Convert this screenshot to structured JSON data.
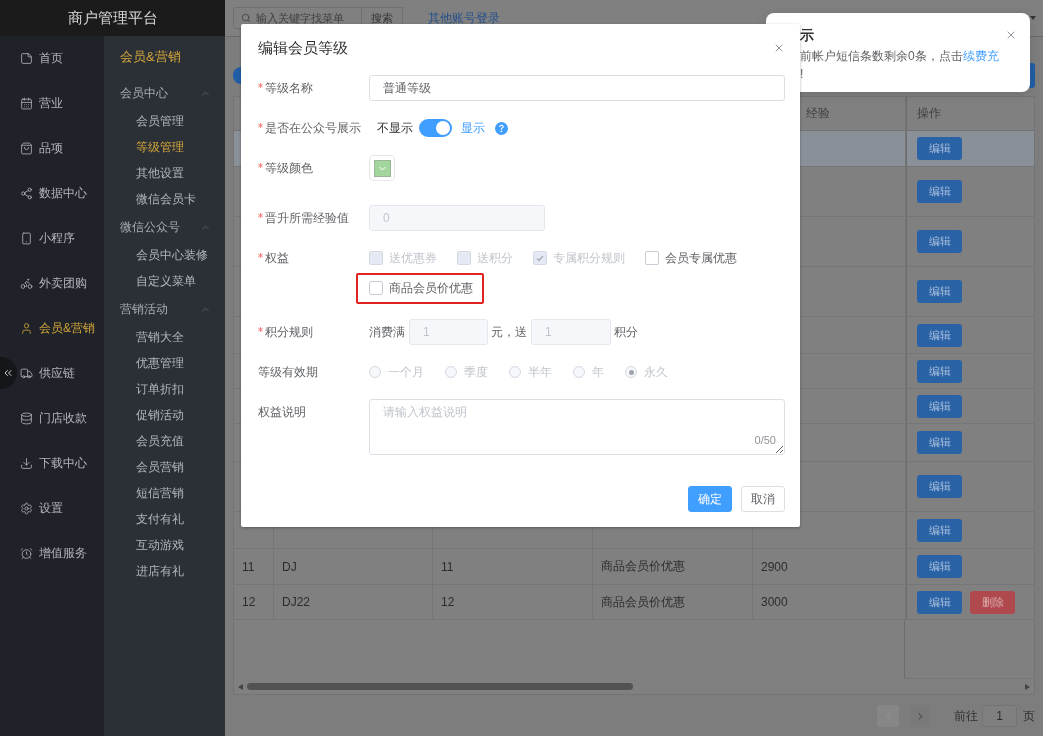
{
  "sidebar": {
    "brand": "商户管理平台",
    "items": [
      {
        "label": "首页",
        "selected": false
      },
      {
        "label": "营业",
        "selected": false
      },
      {
        "label": "品项",
        "selected": false
      },
      {
        "label": "数据中心",
        "selected": false
      },
      {
        "label": "小程序",
        "selected": false
      },
      {
        "label": "外卖团购",
        "selected": false
      },
      {
        "label": "会员&营销",
        "selected": true
      },
      {
        "label": "供应链",
        "selected": false
      },
      {
        "label": "门店收款",
        "selected": false
      },
      {
        "label": "下载中心",
        "selected": false
      },
      {
        "label": "设置",
        "selected": false
      },
      {
        "label": "增值服务",
        "selected": false
      }
    ]
  },
  "submenu": {
    "title": "会员&营销",
    "groups": [
      {
        "title": "会员中心",
        "expanded": true,
        "items": [
          {
            "label": "会员管理",
            "selected": false
          },
          {
            "label": "等级管理",
            "selected": true
          },
          {
            "label": "其他设置",
            "selected": false
          },
          {
            "label": "微信会员卡",
            "selected": false
          }
        ]
      },
      {
        "title": "微信公众号",
        "expanded": true,
        "items": [
          {
            "label": "会员中心装修",
            "selected": false
          },
          {
            "label": "自定义菜单",
            "selected": false
          }
        ]
      },
      {
        "title": "营销活动",
        "expanded": true,
        "items": [
          {
            "label": "营销大全",
            "selected": false
          },
          {
            "label": "优惠管理",
            "selected": false
          },
          {
            "label": "订单折扣",
            "selected": false
          },
          {
            "label": "促销活动",
            "selected": false
          },
          {
            "label": "会员充值",
            "selected": false
          },
          {
            "label": "会员营销",
            "selected": false
          },
          {
            "label": "短信营销",
            "selected": false
          },
          {
            "label": "支付有礼",
            "selected": false
          },
          {
            "label": "互动游戏",
            "selected": false
          },
          {
            "label": "进店有礼",
            "selected": false
          }
        ]
      }
    ]
  },
  "topbar": {
    "search": {
      "placeholder": "输入关键字找菜单"
    },
    "search_button": "搜索",
    "account_link": "其他账号登录"
  },
  "table": {
    "columns": {
      "column_5": "经验",
      "column_6": "操作"
    },
    "rows": [
      {
        "highlighted": true,
        "actions": [
          {
            "label": "编辑",
            "kind": "edit"
          }
        ]
      },
      {
        "highlighted": false,
        "actions": [
          {
            "label": "编辑",
            "kind": "edit"
          }
        ]
      },
      {
        "highlighted": false,
        "actions": [
          {
            "label": "编辑",
            "kind": "edit"
          }
        ]
      },
      {
        "highlighted": false,
        "actions": [
          {
            "label": "编辑",
            "kind": "edit"
          }
        ]
      },
      {
        "highlighted": false,
        "actions": [
          {
            "label": "编辑",
            "kind": "edit"
          }
        ]
      },
      {
        "highlighted": false,
        "actions": [
          {
            "label": "编辑",
            "kind": "edit"
          }
        ]
      },
      {
        "highlighted": false,
        "actions": [
          {
            "label": "编辑",
            "kind": "edit"
          }
        ]
      },
      {
        "highlighted": false,
        "actions": [
          {
            "label": "编辑",
            "kind": "edit"
          }
        ]
      },
      {
        "highlighted": false,
        "actions": [
          {
            "label": "编辑",
            "kind": "edit"
          }
        ]
      },
      {
        "highlighted": false,
        "actions": [
          {
            "label": "编辑",
            "kind": "edit"
          }
        ]
      },
      {
        "highlighted": false,
        "cells": [
          "11",
          "DJ",
          "11",
          "商品会员价优惠",
          "2900"
        ],
        "actions": [
          {
            "label": "编辑",
            "kind": "edit"
          }
        ]
      },
      {
        "highlighted": false,
        "cells": [
          "12",
          "DJ22",
          "12",
          "商品会员价优惠",
          "3000"
        ],
        "actions": [
          {
            "label": "编辑",
            "kind": "edit"
          },
          {
            "label": "删除",
            "kind": "delete"
          }
        ]
      }
    ]
  },
  "pagination": {
    "prev": {
      "disabled": true
    },
    "next": {
      "disabled": false
    },
    "goto": "前往",
    "page": "1",
    "unit": "页"
  },
  "toast": {
    "title": "示",
    "message": "前帐户短信条数剩余0条，点击",
    "link": "续费充",
    "message_end": "!"
  },
  "dialog": {
    "title": "编辑会员等级",
    "fields": [
      {
        "kind": "text",
        "label": "等级名称",
        "required": true,
        "value": "普通等级"
      },
      {
        "kind": "switch",
        "label": "是否在公众号展示",
        "required": true,
        "off_label": "不显示",
        "on_label": "显示",
        "on": true
      },
      {
        "kind": "color",
        "label": "等级颜色",
        "required": true,
        "color": "#a3d69c"
      },
      {
        "kind": "number",
        "label": "晋升所需经验值",
        "required": true,
        "value": "0",
        "disabled": true
      },
      {
        "kind": "checkboxes",
        "label": "权益",
        "required": true,
        "options": [
          {
            "label": "送优惠券",
            "checked": false,
            "disabled": true
          },
          {
            "label": "送积分",
            "checked": false,
            "disabled": true
          },
          {
            "label": "专属积分规则",
            "checked": true,
            "disabled": true
          },
          {
            "label": "会员专属优惠",
            "checked": false,
            "disabled": false
          },
          {
            "label": "商品会员价优惠",
            "checked": false,
            "disabled": false,
            "highlighted": true
          }
        ]
      },
      {
        "kind": "points_rule",
        "label": "积分规则",
        "required": true,
        "disabled": true,
        "prefix": "消费满",
        "amount": "1",
        "middle": "元，送",
        "points": "1",
        "suffix": "积分"
      },
      {
        "kind": "radios",
        "label": "等级有效期",
        "required": false,
        "disabled": true,
        "options": [
          {
            "label": "一个月",
            "selected": false
          },
          {
            "label": "季度",
            "selected": false
          },
          {
            "label": "半年",
            "selected": false
          },
          {
            "label": "年",
            "selected": false
          },
          {
            "label": "永久",
            "selected": true
          }
        ]
      },
      {
        "kind": "textarea",
        "label": "权益说明",
        "required": false,
        "placeholder": "请输入权益说明",
        "counter": "0/50"
      }
    ],
    "buttons": [
      {
        "label": "确定",
        "kind": "primary"
      },
      {
        "label": "取消",
        "kind": "default"
      }
    ]
  }
}
